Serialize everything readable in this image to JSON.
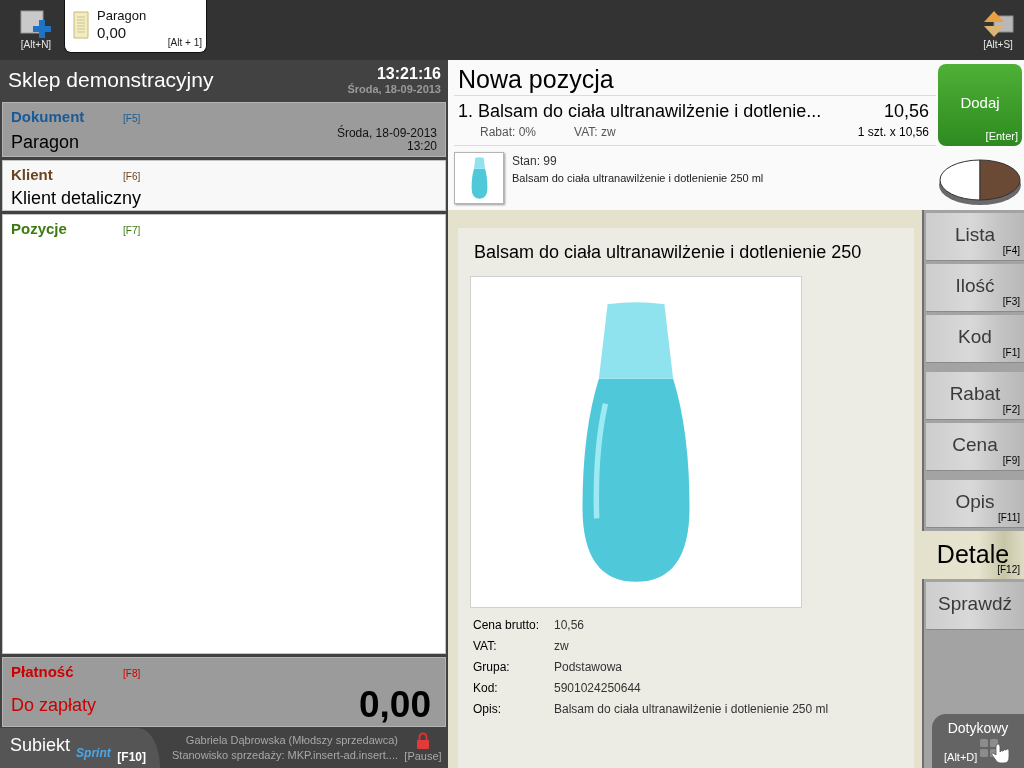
{
  "toolbar": {
    "new_document": {
      "shortcut": "[Alt+N]"
    },
    "document_tabs": [
      {
        "title": "Paragon",
        "amount": "0,00",
        "shortcut": "[Alt + 1]",
        "selected": true
      }
    ],
    "switch_view": {
      "shortcut": "[Alt+S]"
    }
  },
  "store_header": {
    "name": "Sklep demonstracyjny",
    "time": "13:21:16",
    "date": "Środa, 18-09-2013"
  },
  "sections": [
    {
      "kind": "document",
      "title": "Dokument",
      "shortcut": "[F5]",
      "color": "#1a5a96",
      "value": "Paragon",
      "date": "Środa, 18-09-2013",
      "time": "13:20"
    },
    {
      "kind": "customer",
      "title": "Klient",
      "shortcut": "[F6]",
      "color": "#6b4423",
      "value": "Klient detaliczny"
    },
    {
      "kind": "items",
      "title": "Pozycje",
      "shortcut": "[F7]",
      "color": "#3d7a12"
    },
    {
      "kind": "payment",
      "title": "Płatność",
      "shortcut": "[F8]",
      "color": "#cc0000",
      "label": "Do zapłaty",
      "amount": "0,00"
    }
  ],
  "footer": {
    "logo": {
      "name": "Subiekt",
      "edition": "Sprint"
    },
    "menu_shortcut": "[F10]",
    "user": "Gabriela Dąbrowska (Młodszy sprzedawca)",
    "workstation": "Stanowisko sprzedaży: MKP.insert-ad.insert....",
    "lock_shortcut": "[Pause]"
  },
  "new_item": {
    "title": "Nowa pozycja",
    "line": {
      "name": "1. Balsam do ciała ultranawilżenie i dotlenie...",
      "total": "10,56",
      "discount": "Rabat: 0%",
      "vat": "VAT: zw",
      "quantity": "1 szt. x 10,56"
    },
    "stock": "Stan: 99",
    "description": "Balsam do ciała ultranawilżenie i dotlenienie 250 ml"
  },
  "add_button": {
    "label": "Dodaj",
    "shortcut": "[Enter]"
  },
  "details": {
    "title": "Balsam do ciała ultranawilżenie i dotlenienie 250",
    "fields": [
      {
        "label": "Cena brutto:",
        "value": "10,56"
      },
      {
        "label": "VAT:",
        "value": "zw"
      },
      {
        "label": "Grupa:",
        "value": "Podstawowa"
      },
      {
        "label": "Kod:",
        "value": "5901024250644"
      },
      {
        "label": "Opis:",
        "value": "Balsam do ciała ultranawilżenie i dotlenienie 250 ml"
      }
    ]
  },
  "side_tab_groups": [
    {
      "tabs": [
        {
          "label": "Lista",
          "shortcut": "[F4]",
          "selected": false
        },
        {
          "label": "Ilość",
          "shortcut": "[F3]",
          "selected": false
        },
        {
          "label": "Kod",
          "shortcut": "[F1]",
          "selected": false
        }
      ]
    },
    {
      "tabs": [
        {
          "label": "Rabat",
          "shortcut": "[F2]",
          "selected": false
        },
        {
          "label": "Cena",
          "shortcut": "[F9]",
          "selected": false
        }
      ]
    },
    {
      "tabs": [
        {
          "label": "Opis",
          "shortcut": "[F11]",
          "selected": false
        },
        {
          "label": "Detale",
          "shortcut": "[F12]",
          "selected": true
        },
        {
          "label": "Sprawdź",
          "selected": false
        }
      ]
    }
  ],
  "touch_mode": {
    "label": "Dotykowy",
    "shortcut": "[Alt+D]"
  }
}
